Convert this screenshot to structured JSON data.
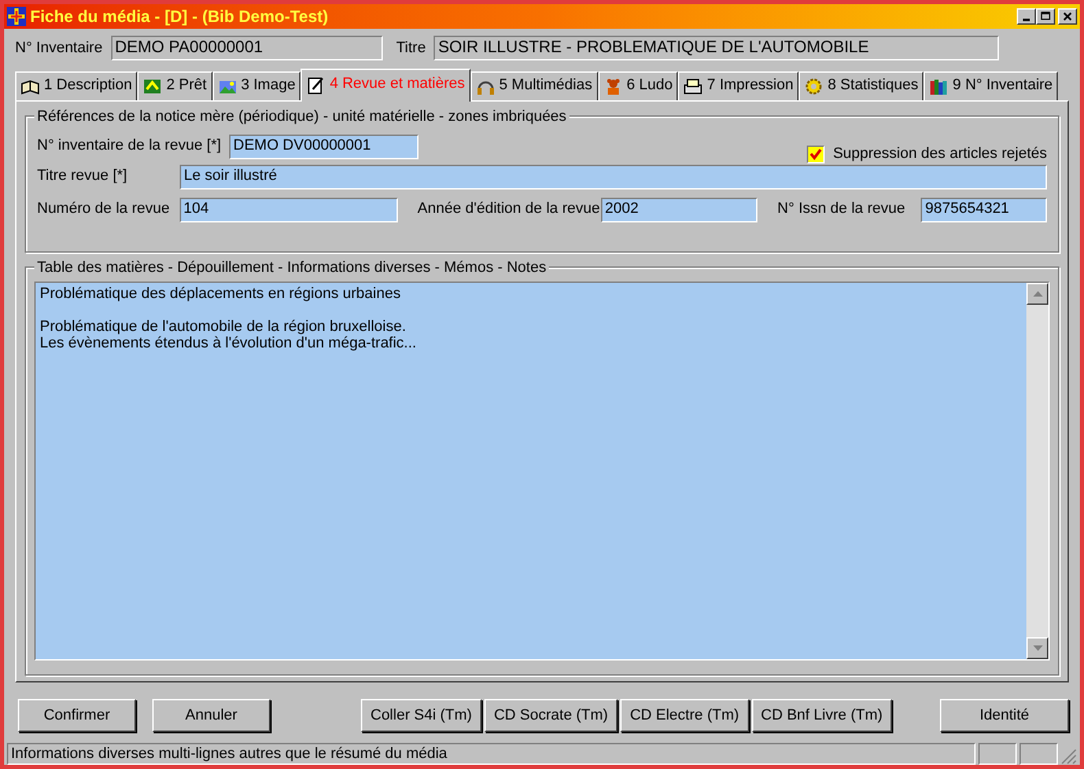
{
  "window": {
    "title": "Fiche du média - [D] - (Bib Demo-Test)"
  },
  "header": {
    "inventory": {
      "label": "N° Inventaire",
      "value": "DEMO PA00000001"
    },
    "title": {
      "label": "Titre",
      "value": "SOIR ILLUSTRE - PROBLEMATIQUE DE L'AUTOMOBILE"
    }
  },
  "tabs": [
    {
      "label": "1 Description",
      "selected": false
    },
    {
      "label": "2 Prêt",
      "selected": false
    },
    {
      "label": "3 Image",
      "selected": false
    },
    {
      "label": "4 Revue et matières",
      "selected": true
    },
    {
      "label": "5 Multimédias",
      "selected": false
    },
    {
      "label": "6 Ludo",
      "selected": false
    },
    {
      "label": "7 Impression",
      "selected": false
    },
    {
      "label": "8 Statistiques",
      "selected": false
    },
    {
      "label": "9 N° Inventaire",
      "selected": false
    }
  ],
  "references": {
    "legend": "Références de la notice mère (périodique) - unité matérielle - zones imbriquées",
    "journal_inventory": {
      "label": "N° inventaire de la revue [*]",
      "value": "DEMO DV00000001"
    },
    "delete_rejected": {
      "label": "Suppression des articles rejetés",
      "checked": true
    },
    "journal_title": {
      "label": "Titre revue [*]",
      "value": "Le soir illustré"
    },
    "issue_number": {
      "label": "Numéro de la revue",
      "value": "104"
    },
    "edition_year": {
      "label": "Année d'édition de la revue",
      "value": "2002"
    },
    "issn": {
      "label": "N° Issn de la revue",
      "value": "9875654321"
    }
  },
  "contents": {
    "legend": "Table des matières - Dépouillement - Informations diverses - Mémos - Notes",
    "text": "Problématique des déplacements en régions urbaines\n\nProblématique de l'automobile de la région bruxelloise.\nLes évènements étendus à l'évolution d'un méga-trafic..."
  },
  "buttons": [
    {
      "label": "Confirmer"
    },
    {
      "label": "Annuler"
    },
    {
      "label": "Coller S4i (Tm)"
    },
    {
      "label": "CD Socrate (Tm)"
    },
    {
      "label": "CD Electre (Tm)"
    },
    {
      "label": "CD Bnf Livre (Tm)"
    },
    {
      "label": "Identité"
    }
  ],
  "status_bar": {
    "text": "Informations diverses multi-lignes autres que le résumé du média"
  }
}
